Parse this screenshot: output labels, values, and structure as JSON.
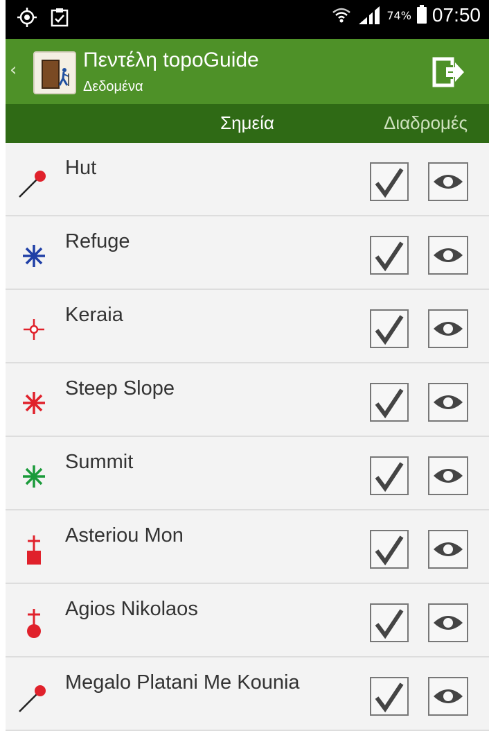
{
  "status_bar": {
    "battery_percent": "74%",
    "time": "07:50",
    "icons": [
      "location-target-icon",
      "clipboard-icon",
      "wifi-icon",
      "signal-icon",
      "battery-icon"
    ]
  },
  "action_bar": {
    "title": "Πεντέλη topoGuide",
    "subtitle": "Δεδομένα",
    "back_icon": "chevron-left-icon",
    "exit_icon": "exit-icon",
    "brand_color": "#4e9128"
  },
  "tabs": [
    {
      "label": "Σημεία",
      "active": true
    },
    {
      "label": "Διαδρομές",
      "active": false
    }
  ],
  "points": [
    {
      "label": "Hut",
      "icon": "red-pin-icon",
      "checked": true
    },
    {
      "label": "Refuge",
      "icon": "blue-asterisk-icon",
      "checked": true
    },
    {
      "label": "Keraia",
      "icon": "red-crosshair-icon",
      "checked": true
    },
    {
      "label": "Steep Slope",
      "icon": "red-asterisk-icon",
      "checked": true
    },
    {
      "label": "Summit",
      "icon": "green-asterisk-icon",
      "checked": true
    },
    {
      "label": "Asteriou Mon",
      "icon": "red-cross-square-icon",
      "checked": true
    },
    {
      "label": "Agios Nikolaos",
      "icon": "red-cross-circle-icon",
      "checked": true
    },
    {
      "label": "Megalo Platani Me Kounia",
      "icon": "red-pin-icon",
      "checked": true
    }
  ],
  "colors": {
    "tab_bar": "#2f6a15",
    "red": "#e0212b",
    "blue": "#1f3fa6",
    "green": "#1a9a3a"
  }
}
